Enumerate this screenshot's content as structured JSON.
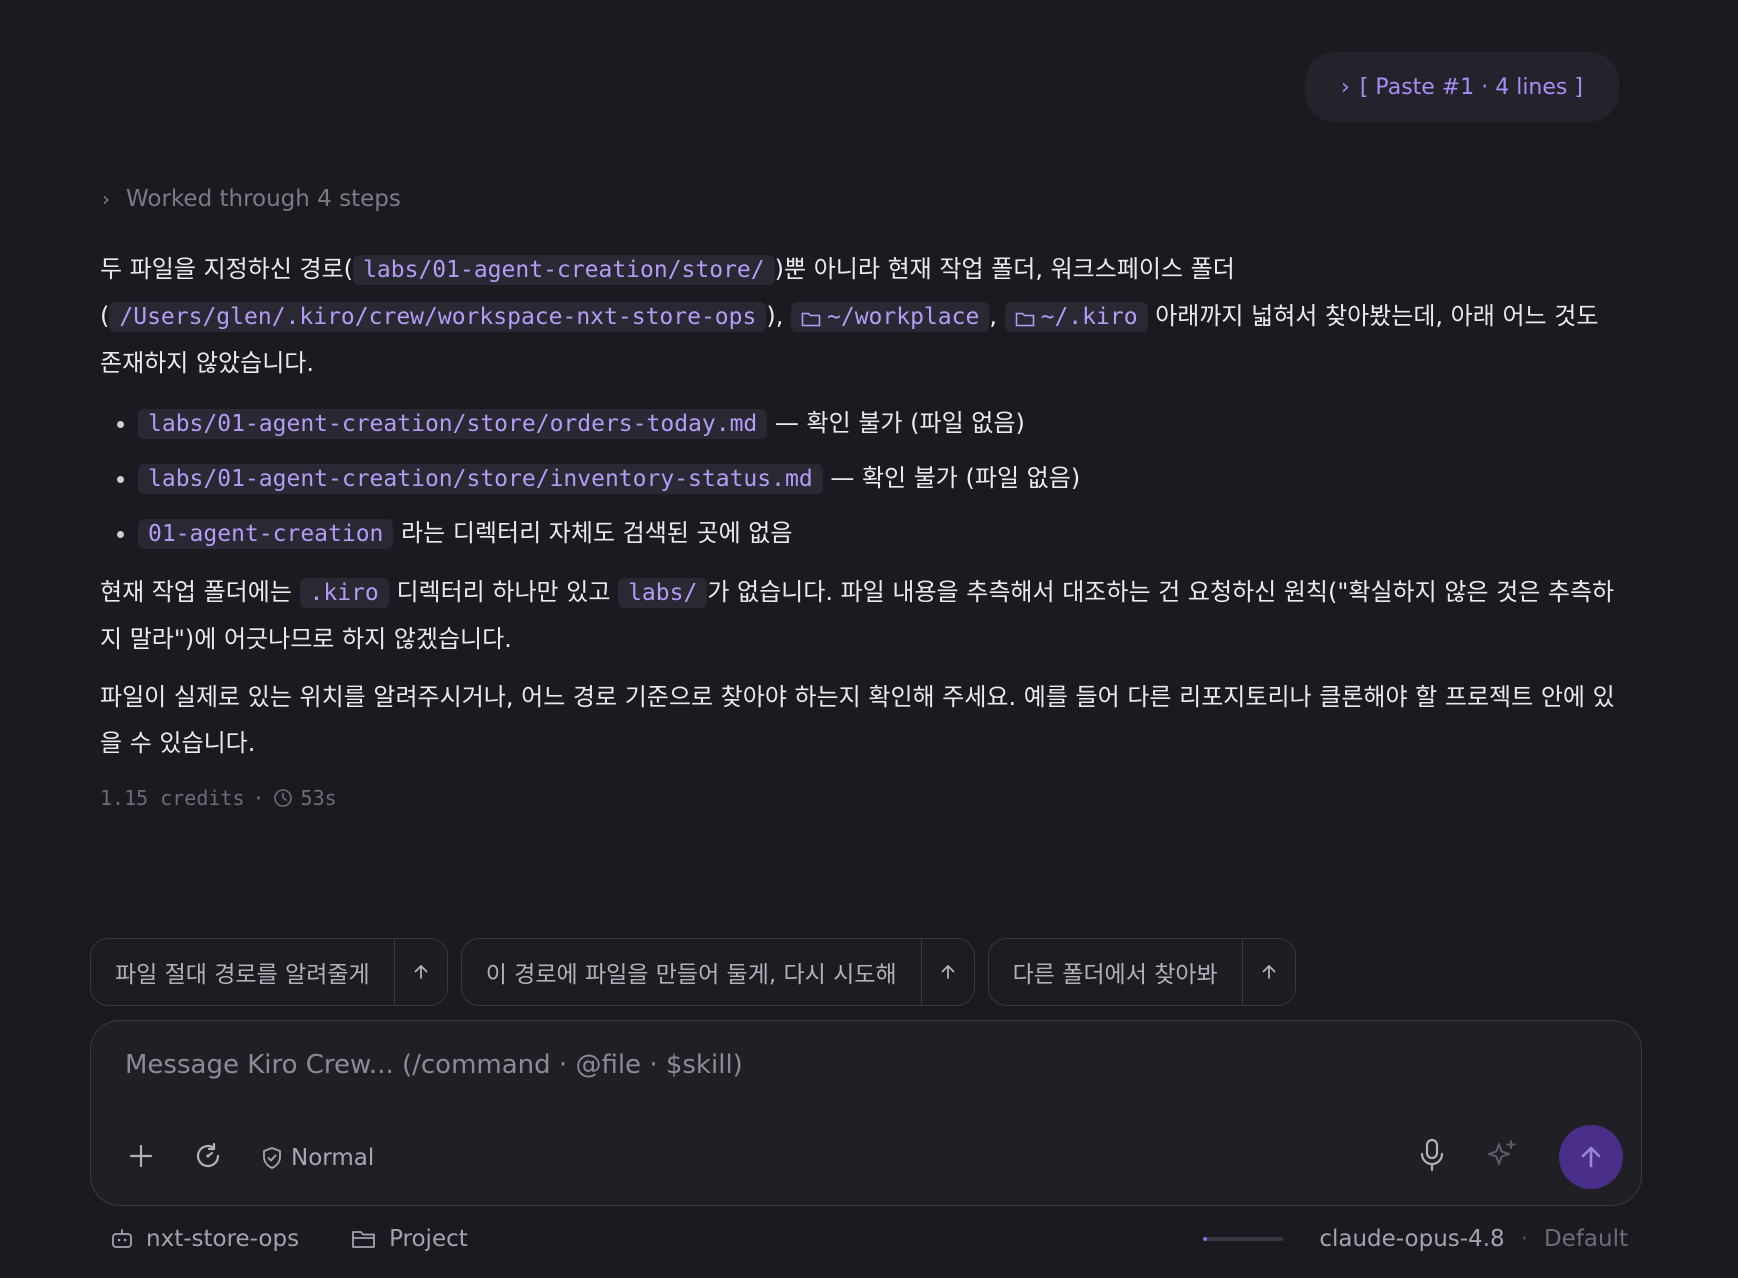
{
  "paste_chip": {
    "label": "[ Paste #1 · 4 lines ]"
  },
  "worked": {
    "label": "Worked through 4 steps"
  },
  "message": {
    "p1": {
      "t1": "두 파일을 지정하신 경로(",
      "c1": "labs/01-agent-creation/store/",
      "t2": ")뿐 아니라 현재 작업 폴더, 워크스페이스 폴더(",
      "c2": "/Users/glen/.kiro/crew/workspace-nxt-store-ops",
      "t3": "),",
      "c3": "~/workplace",
      "t4": ",",
      "c4": "~/.kiro",
      "t5": "아래까지 넓혀서 찾아봤는데, 아래 어느 것도 존재하지 않았습니다."
    },
    "bullets": [
      {
        "code": "labs/01-agent-creation/store/orders-today.md",
        "text": "— 확인 불가 (파일 없음)"
      },
      {
        "code": "labs/01-agent-creation/store/inventory-status.md",
        "text": "— 확인 불가 (파일 없음)"
      },
      {
        "code": "01-agent-creation",
        "text": "라는 디렉터리 자체도 검색된 곳에 없음"
      }
    ],
    "p2": {
      "t1": "현재 작업 폴더에는",
      "c1": ".kiro",
      "t2": "디렉터리 하나만 있고",
      "c2": "labs/",
      "t3": "가 없습니다. 파일 내용을 추측해서 대조하는 건 요청하신 원칙(\"확실하지 않은 것은 추측하지 말라\")에 어긋나므로 하지 않겠습니다."
    },
    "p3": "파일이 실제로 있는 위치를 알려주시거나, 어느 경로 기준으로 찾아야 하는지 확인해 주세요. 예를 들어 다른 리포지토리나 클론해야 할 프로젝트 안에 있을 수 있습니다."
  },
  "meta": {
    "credits": "1.15 credits",
    "sep": "·",
    "duration": "53s"
  },
  "suggestions": [
    {
      "label": "파일 절대 경로를 알려줄게"
    },
    {
      "label": "이 경로에 파일을 만들어 둘게, 다시 시도해"
    },
    {
      "label": "다른 폴더에서 찾아봐"
    }
  ],
  "composer": {
    "placeholder": "Message Kiro Crew... (/command · @file · $skill)",
    "mode_label": "Normal"
  },
  "footer": {
    "agent": "nxt-store-ops",
    "project": "Project",
    "context_usage_fraction": 0.05,
    "model": "claude-opus-4.8",
    "sep": "·",
    "mode": "Default"
  },
  "colors": {
    "accent": "#a98cf5",
    "background": "#1b1a20",
    "send_button": "#4a2f8a"
  }
}
